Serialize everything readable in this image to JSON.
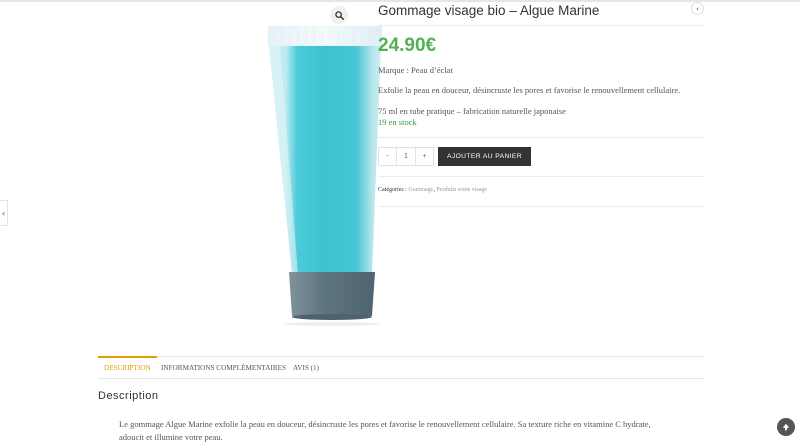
{
  "product": {
    "title": "Gommage visage bio – Algue Marine",
    "price": "24.90€",
    "brand": "Marque : Peau d’éclat",
    "short_description": "Exfolie la peau en douceur, désincruste les pores et favorise le renouvellement cellulaire.",
    "volume": "75 ml en tube pratique – fabrication naturelle japonaise",
    "stock": "19 en stock",
    "quantity": "1",
    "quantity_minus": "-",
    "quantity_plus": "+",
    "add_to_cart": "AJOUTER AU PANIER",
    "categories_label": "Catégories :",
    "categories": [
      "Gommage",
      "Produits soins visage"
    ],
    "categories_sep": ", "
  },
  "nav": {
    "prev_glyph": "‹",
    "next_glyph": "‹"
  },
  "tabs": {
    "items": [
      {
        "label": "DESCRIPTION"
      },
      {
        "label": "INFORMATIONS COMPLÉMENTAIRES"
      },
      {
        "label": "AVIS (1)"
      }
    ],
    "active_index": 0
  },
  "description": {
    "heading": "Description",
    "line1": "Le gommage Algue Marine exfolie la peau en douceur, désincruste les pores et favorise le renouvellement cellulaire. Sa texture riche en vitamine C hydrate,",
    "line2": "adoucit et illumine votre peau."
  },
  "icons": {
    "zoom": "search-icon",
    "scroll_top": "arrow-up-icon"
  },
  "colors": {
    "price": "#52b252",
    "stock": "#3a9a3a",
    "accent": "#e0a100",
    "button": "#333333"
  }
}
